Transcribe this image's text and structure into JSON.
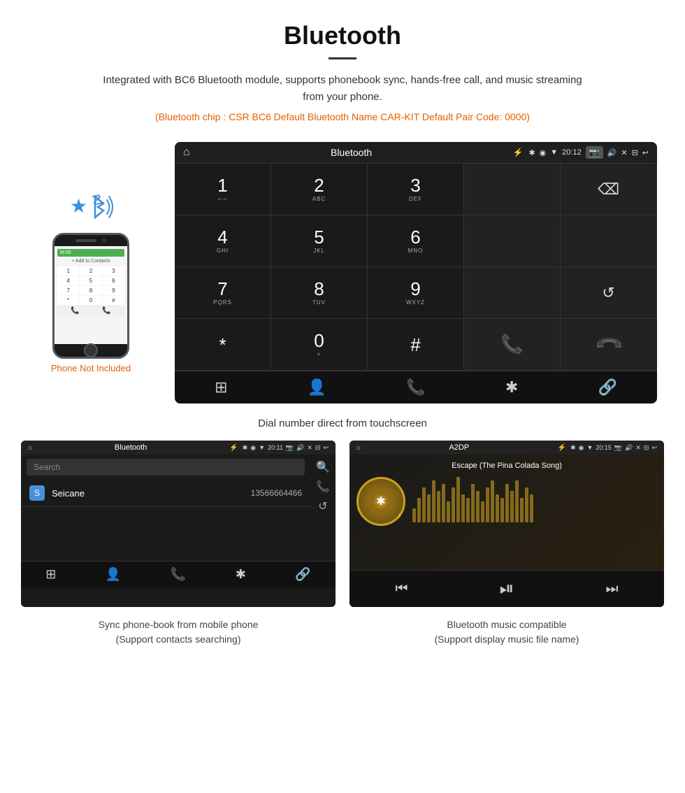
{
  "header": {
    "title": "Bluetooth",
    "description": "Integrated with BC6 Bluetooth module, supports phonebook sync, hands-free call, and music streaming from your phone.",
    "specs": "(Bluetooth chip : CSR BC6   Default Bluetooth Name CAR-KIT    Default Pair Code: 0000)"
  },
  "phone_illustration": {
    "not_included_label": "Phone Not Included",
    "call_bar": "M:00",
    "contact_label": "+ Add to Contacts",
    "keys": [
      "1",
      "2",
      "3",
      "4",
      "5",
      "6",
      "7",
      "8",
      "9",
      "*",
      "0",
      "#"
    ]
  },
  "dialpad_screen": {
    "status_bar": {
      "home_icon": "⌂",
      "title": "Bluetooth",
      "usb_icon": "⚡",
      "time": "20:12",
      "icons": "📷 🔊 ✕ ⊟ ↩"
    },
    "keys": [
      {
        "num": "1",
        "sub": "∽∽"
      },
      {
        "num": "2",
        "sub": "ABC"
      },
      {
        "num": "3",
        "sub": "DEF"
      },
      {
        "num": "",
        "sub": ""
      },
      {
        "num": "⌫",
        "sub": ""
      },
      {
        "num": "4",
        "sub": "GHI"
      },
      {
        "num": "5",
        "sub": "JKL"
      },
      {
        "num": "6",
        "sub": "MNO"
      },
      {
        "num": "",
        "sub": ""
      },
      {
        "num": "",
        "sub": ""
      },
      {
        "num": "7",
        "sub": "PQRS"
      },
      {
        "num": "8",
        "sub": "TUV"
      },
      {
        "num": "9",
        "sub": "WXYZ"
      },
      {
        "num": "",
        "sub": ""
      },
      {
        "num": "↺",
        "sub": ""
      },
      {
        "num": "*",
        "sub": ""
      },
      {
        "num": "0",
        "sub": "+"
      },
      {
        "num": "#",
        "sub": ""
      },
      {
        "num": "📞",
        "sub": "green"
      },
      {
        "num": "📞",
        "sub": "red"
      }
    ],
    "nav_icons": [
      "⊞",
      "👤",
      "📞",
      "✱",
      "🔗"
    ]
  },
  "dialpad_caption": "Dial number direct from touchscreen",
  "phonebook_screen": {
    "status": {
      "home": "⌂",
      "title": "Bluetooth",
      "usb": "⚡",
      "time": "20:11",
      "right_icons": "📷 🔊 ✕ ⊟ ↩"
    },
    "search_placeholder": "Search",
    "contact": {
      "letter": "S",
      "name": "Seicane",
      "number": "13566664466"
    },
    "side_icons": [
      "🔍",
      "📞",
      "↺"
    ],
    "nav_icons": [
      "⊞",
      "👤",
      "📞",
      "✱",
      "🔗"
    ],
    "active_nav": 1
  },
  "music_screen": {
    "status": {
      "home": "⌂",
      "title": "A2DP",
      "usb": "⚡",
      "time": "20:15",
      "right_icons": "📷 🔊 ✕ ⊟ ↩"
    },
    "song_title": "Escape (The Pina Colada Song)",
    "viz_bars": [
      20,
      35,
      50,
      40,
      60,
      45,
      55,
      30,
      50,
      65,
      40,
      35,
      55,
      45,
      30,
      50,
      60,
      40,
      35,
      55,
      45,
      60,
      35,
      50,
      40
    ],
    "nav_icons": [
      "⏮",
      "⏯",
      "⏭"
    ]
  },
  "bottom_captions": [
    {
      "line1": "Sync phone-book from mobile phone",
      "line2": "(Support contacts searching)"
    },
    {
      "line1": "Bluetooth music compatible",
      "line2": "(Support display music file name)"
    }
  ]
}
